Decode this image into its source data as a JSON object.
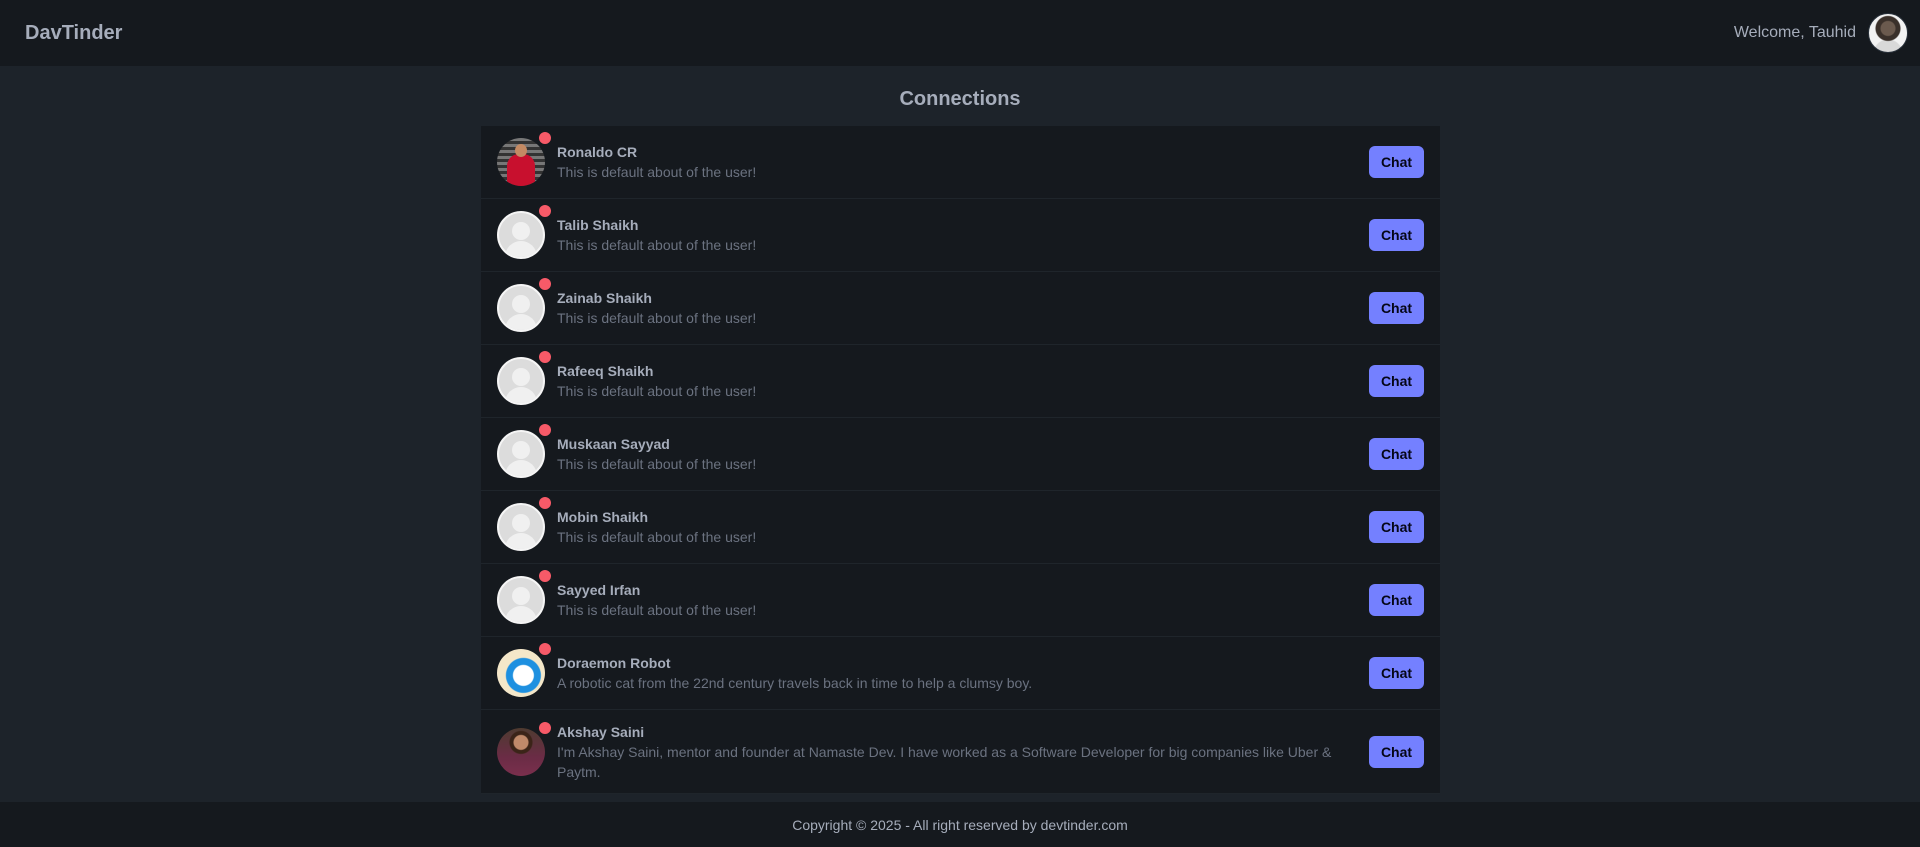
{
  "navbar": {
    "brand": "DavTinder",
    "welcome": "Welcome, Tauhid",
    "avatar_icon": "user-avatar-icon"
  },
  "page": {
    "title": "Connections"
  },
  "connections": [
    {
      "name": "Ronaldo CR",
      "about": "This is default about of the user!",
      "avatar": "photo-ronaldo",
      "chat_label": "Chat"
    },
    {
      "name": "Talib Shaikh",
      "about": "This is default about of the user!",
      "avatar": "default",
      "chat_label": "Chat"
    },
    {
      "name": "Zainab Shaikh",
      "about": "This is default about of the user!",
      "avatar": "default",
      "chat_label": "Chat"
    },
    {
      "name": "Rafeeq Shaikh",
      "about": "This is default about of the user!",
      "avatar": "default",
      "chat_label": "Chat"
    },
    {
      "name": "Muskaan Sayyad",
      "about": "This is default about of the user!",
      "avatar": "default",
      "chat_label": "Chat"
    },
    {
      "name": "Mobin Shaikh",
      "about": "This is default about of the user!",
      "avatar": "default",
      "chat_label": "Chat"
    },
    {
      "name": "Sayyed Irfan",
      "about": "This is default about of the user!",
      "avatar": "default",
      "chat_label": "Chat"
    },
    {
      "name": "Doraemon Robot",
      "about": "A robotic cat from the 22nd century travels back in time to help a clumsy boy.",
      "avatar": "photo-doraemon",
      "chat_label": "Chat"
    },
    {
      "name": "Akshay Saini",
      "about": "I'm Akshay Saini, mentor and founder at Namaste Dev. I have worked as a Software Developer for big companies like Uber & Paytm.",
      "avatar": "photo-akshay",
      "chat_label": "Chat"
    }
  ],
  "footer": {
    "copyright": "Copyright © 2025 - All right reserved by devtinder.com"
  },
  "colors": {
    "background": "#1d232a",
    "navbar": "#15191e",
    "primary": "#7480ff",
    "status_dot": "#f75a68"
  }
}
